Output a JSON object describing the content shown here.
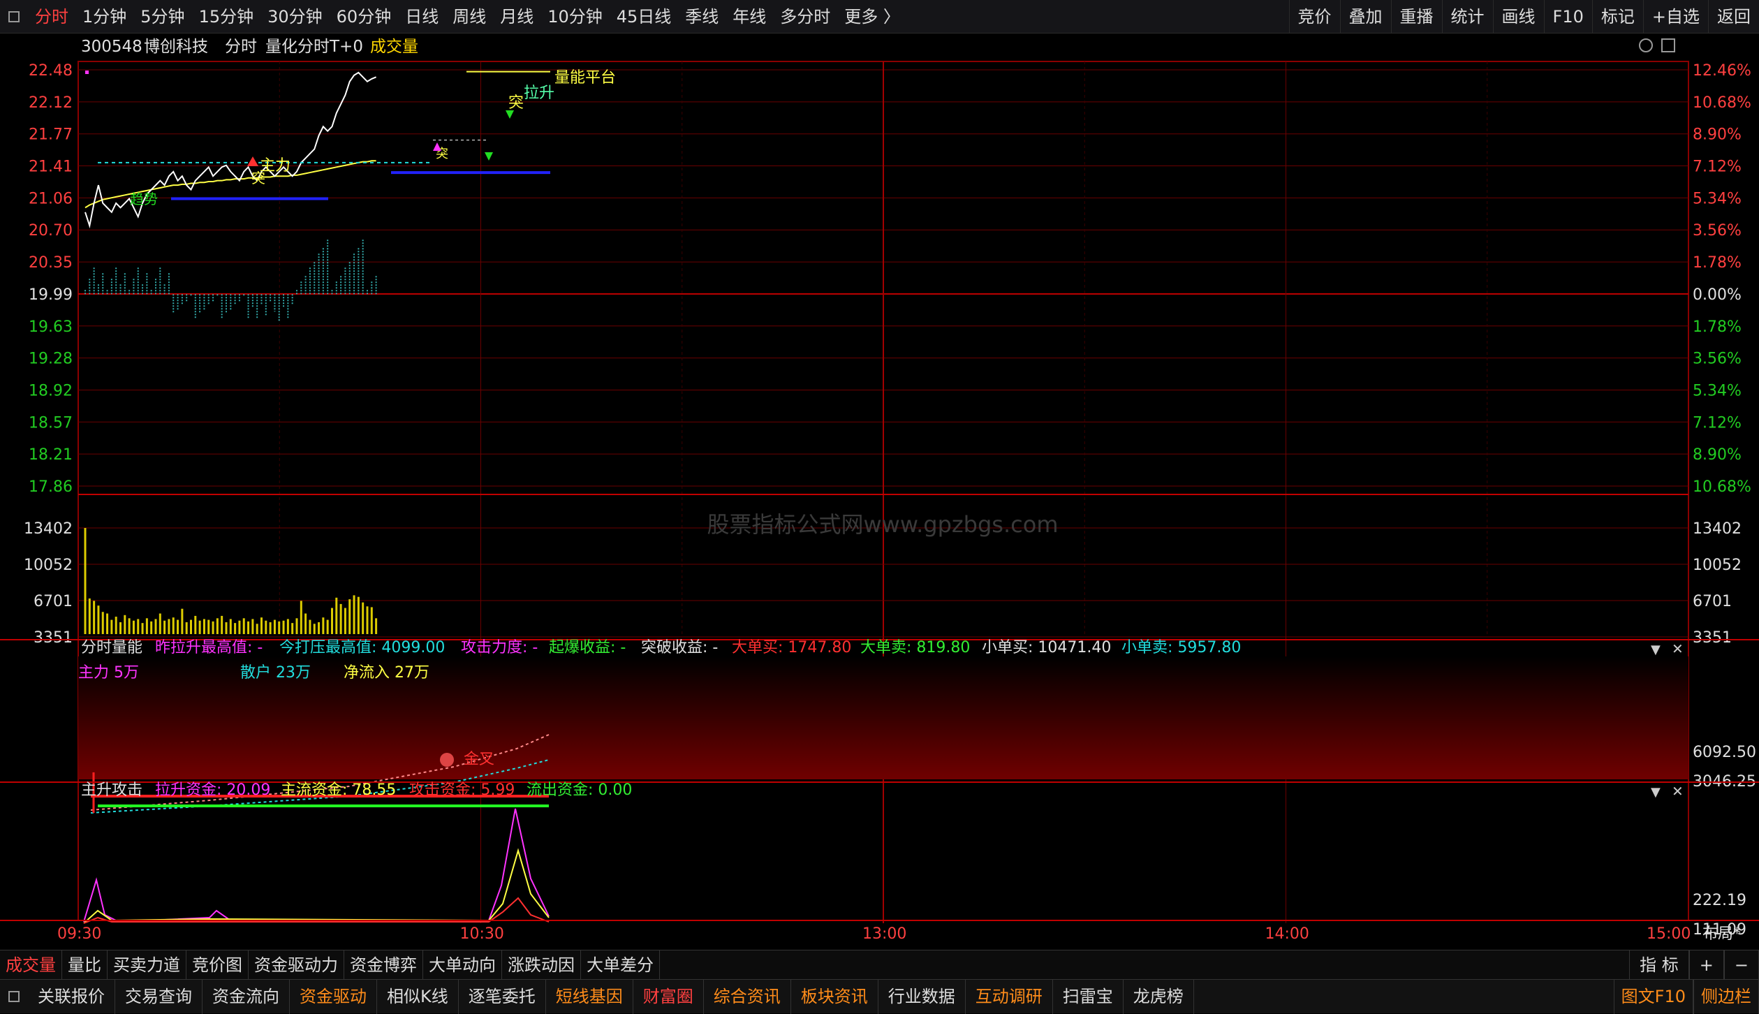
{
  "toolbar": {
    "periods": [
      "分时",
      "1分钟",
      "5分钟",
      "15分钟",
      "30分钟",
      "60分钟",
      "日线",
      "周线",
      "月线",
      "10分钟",
      "45日线",
      "季线",
      "年线",
      "多分时",
      "更多 〉"
    ],
    "right_buttons": [
      "竞价",
      "叠加",
      "重播",
      "统计",
      "画线",
      "F10",
      "标记",
      "+自选",
      "返回"
    ]
  },
  "header": {
    "code": "300548",
    "name": "博创科技",
    "mode": "分时",
    "indicator": "量化分时T+0",
    "volume_label": "成交量"
  },
  "price_axis_left": [
    "22.48",
    "22.12",
    "21.77",
    "21.41",
    "21.06",
    "20.70",
    "20.35",
    "19.99",
    "19.63",
    "19.28",
    "18.92",
    "18.57",
    "18.21",
    "17.86"
  ],
  "pct_axis_right": [
    "12.46%",
    "10.68%",
    "8.90%",
    "7.12%",
    "5.34%",
    "3.56%",
    "1.78%",
    "0.00%",
    "1.78%",
    "3.56%",
    "5.34%",
    "7.12%",
    "8.90%",
    "10.68%"
  ],
  "volume_axis": [
    "13402",
    "10052",
    "6701",
    "3351"
  ],
  "annotations": {
    "a1": "量能平台",
    "a2": "拉升",
    "a3": "突",
    "a4": "主力",
    "a5": "突",
    "a6": "突",
    "a7": "趋势"
  },
  "panel1": {
    "title": "分时量能",
    "f1": "昨拉升最高值: -",
    "f2": "今打压最高值: 4099.00",
    "f3": "攻击力度: -",
    "f4": "起爆收益: -",
    "f5": "突破收益: -",
    "f6": "大单买: 1747.80",
    "f7": "大单卖: 819.80",
    "f8": "小单买: 10471.40",
    "f9": "小单卖: 5957.80",
    "l1": "主力 5万",
    "l2": "散户 23万",
    "l3": "净流入 27万",
    "mark": "金叉",
    "axis": [
      "6092.50",
      "3046.25"
    ]
  },
  "panel2": {
    "title": "主升攻击",
    "f1": "拉升资金: 20.09",
    "f2": "主流资金: 78.55",
    "f3": "攻击资金: 5.99",
    "f4": "流出资金: 0.00",
    "axis": [
      "222.19",
      "111.09"
    ]
  },
  "time_axis": [
    "09:30",
    "10:30",
    "13:00",
    "14:00",
    "15:00"
  ],
  "layout_btn": "布局*",
  "watermark": "股票指标公式网www.gpzbgs.com",
  "bottom_tabs": [
    "成交量",
    "量比",
    "买卖力道",
    "竞价图",
    "资金驱动力",
    "资金博弈",
    "大单动向",
    "涨跌动因",
    "大单差分"
  ],
  "bottom_right": [
    "指 标",
    "+",
    "−"
  ],
  "bottom2": [
    "关联报价",
    "交易查询",
    "资金流向",
    "资金驱动",
    "相似K线",
    "逐笔委托",
    "短线基因",
    "财富圈",
    "综合资讯",
    "板块资讯",
    "行业数据",
    "互动调研",
    "扫雷宝",
    "龙虎榜"
  ],
  "bottom2_right": [
    "图文F10",
    "侧边栏"
  ],
  "colors": {
    "up": "#ff3030",
    "down": "#22cc22",
    "grid": "#7a0000",
    "accent": "#ffff44"
  },
  "chart_data": {
    "type": "line",
    "title": "",
    "xlabel": "",
    "ylabel": "",
    "x_ticks": [
      "09:30",
      "10:30",
      "13:00",
      "14:00",
      "15:00"
    ],
    "ylim": [
      17.86,
      22.48
    ],
    "prev_close": 19.99,
    "price": [
      20.9,
      20.75,
      21.0,
      21.2,
      21.0,
      20.95,
      20.9,
      21.0,
      20.95,
      21.0,
      21.05,
      20.95,
      20.85,
      21.0,
      21.1,
      21.15,
      21.2,
      21.25,
      21.2,
      21.3,
      21.35,
      21.25,
      21.3,
      21.2,
      21.15,
      21.25,
      21.3,
      21.35,
      21.4,
      21.3,
      21.35,
      21.4,
      21.42,
      21.35,
      21.3,
      21.25,
      21.35,
      21.4,
      21.3,
      21.25,
      21.35,
      21.4,
      21.35,
      21.3,
      21.35,
      21.4,
      21.35,
      21.3,
      21.35,
      21.45,
      21.5,
      21.55,
      21.6,
      21.75,
      21.85,
      21.8,
      21.85,
      22.0,
      22.1,
      22.2,
      22.35,
      22.42,
      22.45,
      22.4,
      22.35,
      22.38,
      22.4
    ],
    "avg_price": [
      20.95,
      20.98,
      21.0,
      21.02,
      21.04,
      21.05,
      21.06,
      21.07,
      21.08,
      21.09,
      21.1,
      21.11,
      21.12,
      21.13,
      21.14,
      21.15,
      21.16,
      21.17,
      21.18,
      21.19,
      21.2,
      21.2,
      21.21,
      21.21,
      21.22,
      21.22,
      21.23,
      21.23,
      21.24,
      21.24,
      21.25,
      21.25,
      21.26,
      21.26,
      21.27,
      21.27,
      21.27,
      21.28,
      21.28,
      21.28,
      21.29,
      21.29,
      21.29,
      21.3,
      21.3,
      21.3,
      21.3,
      21.31,
      21.31,
      21.32,
      21.33,
      21.34,
      21.35,
      21.36,
      21.37,
      21.38,
      21.39,
      21.4,
      21.41,
      21.42,
      21.43,
      21.44,
      21.45,
      21.46,
      21.46,
      21.47,
      21.47
    ],
    "volume": [
      13402,
      4500,
      4200,
      3600,
      2800,
      2600,
      1800,
      2200,
      1500,
      2400,
      2000,
      1700,
      1900,
      1400,
      2000,
      1600,
      1900,
      2600,
      1700,
      1900,
      2100,
      1800,
      3200,
      1500,
      1800,
      2300,
      1700,
      1900,
      1800,
      1600,
      2000,
      2300,
      1500,
      1900,
      1400,
      1700,
      2000,
      1600,
      1900,
      1300,
      2100,
      1700,
      1500,
      1800,
      1600,
      1700,
      1900,
      1400,
      2000,
      4200,
      2600,
      1800,
      1300,
      1500,
      2100,
      1800,
      3300,
      4600,
      3800,
      3300,
      4400,
      4900,
      4700,
      4000,
      3500,
      3400,
      2000
    ]
  }
}
